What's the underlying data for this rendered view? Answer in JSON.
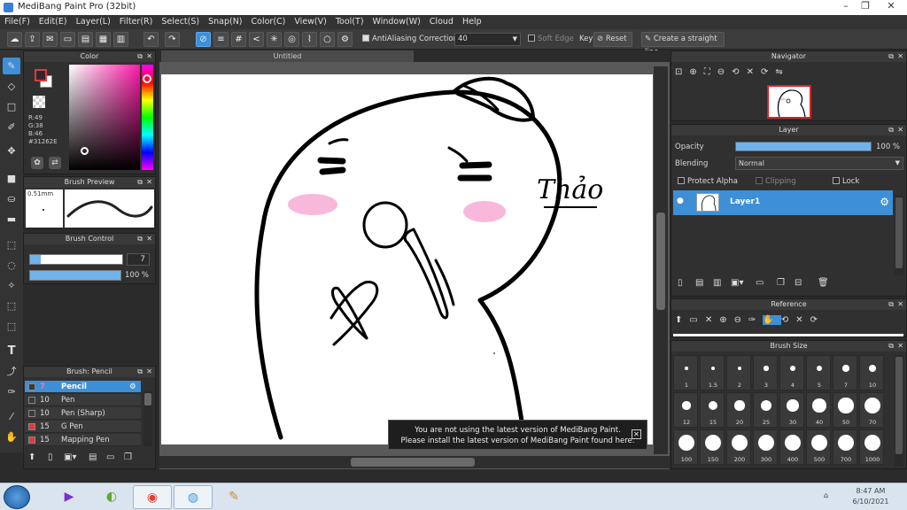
{
  "window": {
    "title": "MediBang Paint Pro (32bit)"
  },
  "menu": [
    "File(F)",
    "Edit(E)",
    "Layer(L)",
    "Filter(R)",
    "Select(S)",
    "Snap(N)",
    "Color(C)",
    "View(V)",
    "Tool(T)",
    "Window(W)",
    "Cloud",
    "Help"
  ],
  "toolbar": {
    "antialiasing_label": "AntiAliasing",
    "correction_label": "Correction",
    "correction_value": "40",
    "soft_edge_label": "Soft Edge",
    "key_label": "Key",
    "reset_label": "Reset",
    "straight_line_label": "Create a straight line"
  },
  "color_panel": {
    "title": "Color",
    "r": "R:49",
    "g": "G:38",
    "b": "B:46",
    "hex": "#31262E",
    "primary_color": "#31262e",
    "secondary_color": "#ffffff"
  },
  "brush_preview": {
    "title": "Brush Preview",
    "size": "0.51mm"
  },
  "brush_control": {
    "title": "Brush Control",
    "size_value": "7",
    "opacity_value": "100 %"
  },
  "brush_list": {
    "title": "Brush: Pencil",
    "items": [
      {
        "size": "7",
        "name": "Pencil",
        "color": "#3a3a3a",
        "selected": true
      },
      {
        "size": "10",
        "name": "Pen",
        "color": "#3a3a3a",
        "selected": false
      },
      {
        "size": "10",
        "name": "Pen (Sharp)",
        "color": "#3a3a3a",
        "selected": false
      },
      {
        "size": "15",
        "name": "G Pen",
        "color": "#e03a3a",
        "selected": false
      },
      {
        "size": "15",
        "name": "Mapping Pen",
        "color": "#e03a3a",
        "selected": false
      }
    ]
  },
  "canvas": {
    "tab_title": "Untitled",
    "signature": "Thảo"
  },
  "notice": {
    "line1": "You are not using the latest version of MediBang Paint.",
    "line2": "Please install the latest version of MediBang Paint found here."
  },
  "navigator": {
    "title": "Navigator"
  },
  "layer_panel": {
    "title": "Layer",
    "opacity_label": "Opacity",
    "opacity_value": "100 %",
    "opacity_fraction": 1.0,
    "blending_label": "Blending",
    "blending_value": "Normal",
    "protect_alpha": "Protect Alpha",
    "clipping": "Clipping",
    "lock": "Lock",
    "layer_name": "Layer1"
  },
  "reference": {
    "title": "Reference"
  },
  "brush_size": {
    "title": "Brush Size",
    "sizes": [
      "1",
      "1.5",
      "2",
      "3",
      "4",
      "5",
      "7",
      "10",
      "12",
      "15",
      "20",
      "25",
      "30",
      "40",
      "50",
      "70",
      "100",
      "150",
      "200",
      "300",
      "400",
      "500",
      "700",
      "1000"
    ]
  },
  "taskbar": {
    "time": "8:47 AM",
    "date": "6/10/2021"
  }
}
